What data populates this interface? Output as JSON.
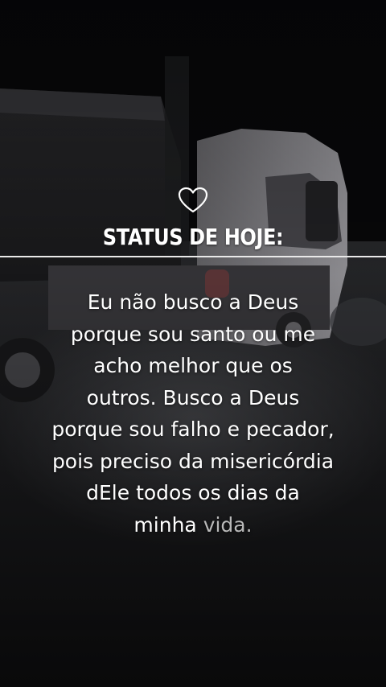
{
  "status": {
    "heart_icon": "heart-outline-icon",
    "title": "STATUS DE HOJE:"
  },
  "quote": {
    "lines": [
      "Eu não busco a Deus",
      "porque sou santo ou me",
      "acho melhor que os",
      "outros. Busco a Deus",
      "porque sou falho e pecador,",
      "pois preciso da misericórdia",
      "dEle todos os dias da"
    ],
    "last_line_start": "minha ",
    "last_line_end": "vida."
  },
  "colors": {
    "text": "#ffffff",
    "divider": "#e9e9e9",
    "faded_text": "#b9b9b9"
  }
}
